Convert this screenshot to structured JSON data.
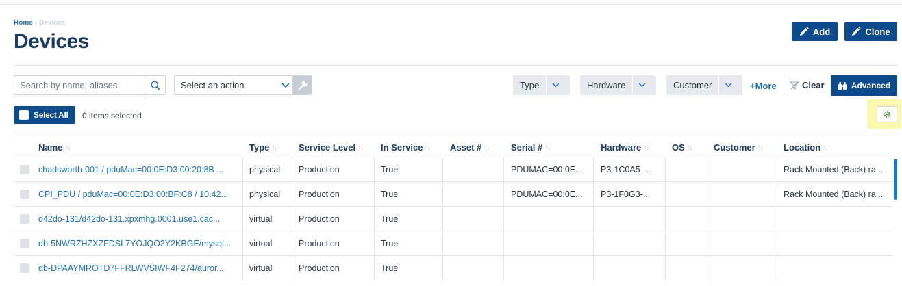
{
  "breadcrumb": {
    "home": "Home",
    "separator": "›",
    "current": "Devices"
  },
  "page_title": "Devices",
  "header_buttons": {
    "add": "Add",
    "clone": "Clone"
  },
  "search": {
    "placeholder": "Search by name, aliases",
    "value": ""
  },
  "action_select": {
    "label": "Select an action"
  },
  "filters": {
    "type": "Type",
    "hardware": "Hardware",
    "customer": "Customer",
    "more": "+More",
    "clear": "Clear",
    "advanced": "Advanced"
  },
  "selection": {
    "select_all": "Select All",
    "items_selected": "0 items selected"
  },
  "colors": {
    "primary": "#0d4a8c",
    "link": "#1f6fb8",
    "title": "#1d3a5f",
    "highlight": "#fbf8b0",
    "scrollbar": "#1a76d2"
  },
  "icons": {
    "search": "search-icon",
    "chevron": "chevron-down-icon",
    "wrench": "wrench-icon",
    "pencil": "pencil-icon",
    "binoculars": "binoculars-icon",
    "clear_filter": "clear-filter-icon",
    "gear": "gear-icon",
    "sort": "sort-icon"
  },
  "table": {
    "columns": [
      "Name",
      "Type",
      "Service Level",
      "In Service",
      "Asset #",
      "Serial #",
      "Hardware",
      "OS",
      "Customer",
      "Location"
    ],
    "rows": [
      {
        "name": "chadsworth-001 / pduMac=00:0E:D3:00:20:8B ...",
        "type": "physical",
        "service_level": "Production",
        "in_service": "True",
        "asset": "",
        "serial": "PDUMAC=00:0E...",
        "hardware": "P3-1C0A5-...",
        "os": "",
        "customer": "",
        "location": "Rack Mounted (Back) ra..."
      },
      {
        "name": "CPI_PDU / pduMac=00:0E:D3:00:BF:C8 / 10.42...",
        "type": "physical",
        "service_level": "Production",
        "in_service": "True",
        "asset": "",
        "serial": "PDUMAC=00:0E...",
        "hardware": "P3-1F0G3-...",
        "os": "",
        "customer": "",
        "location": "Rack Mounted (Back) ra..."
      },
      {
        "name": "d42do-131/d42do-131.xpxmhg.0001.use1.cac...",
        "type": "virtual",
        "service_level": "Production",
        "in_service": "True",
        "asset": "",
        "serial": "",
        "hardware": "",
        "os": "",
        "customer": "",
        "location": ""
      },
      {
        "name": "db-5NWRZHZXZFDSL7YOJQO2Y2KBGE/mysql...",
        "type": "virtual",
        "service_level": "Production",
        "in_service": "True",
        "asset": "",
        "serial": "",
        "hardware": "",
        "os": "",
        "customer": "",
        "location": ""
      },
      {
        "name": "db-DPAAYMROTD7FFRLWVSIWF4F274/auror...",
        "type": "virtual",
        "service_level": "Production",
        "in_service": "True",
        "asset": "",
        "serial": "",
        "hardware": "",
        "os": "",
        "customer": "",
        "location": ""
      }
    ]
  }
}
